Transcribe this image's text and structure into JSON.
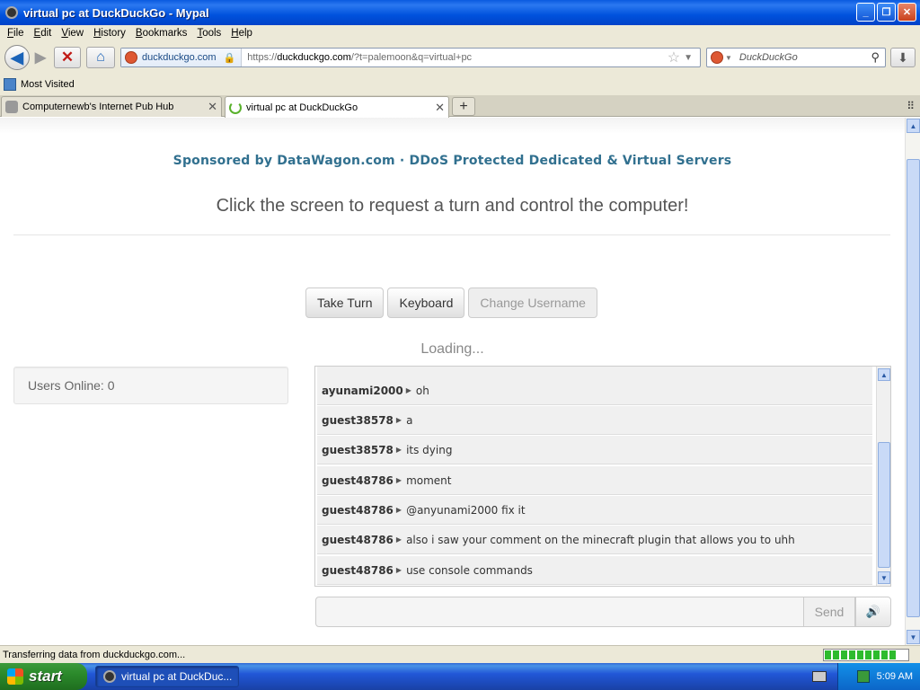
{
  "window": {
    "title": "virtual pc at DuckDuckGo - Mypal",
    "buttons": {
      "minimize": "_",
      "restore": "❐",
      "close": "✕"
    }
  },
  "menu": [
    "File",
    "Edit",
    "View",
    "History",
    "Bookmarks",
    "Tools",
    "Help"
  ],
  "nav": {
    "back_icon": "◀",
    "forward_icon": "▶",
    "stop_icon": "✕",
    "home_icon": "⌂",
    "identity": "duckduckgo.com",
    "url_prefix": "https://",
    "url_host": "duckduckgo.com",
    "url_path": "/?t=palemoon&q=virtual+pc",
    "search_placeholder": "DuckDuckGo",
    "download_icon": "⬇"
  },
  "bookmarks": {
    "most_visited": "Most Visited"
  },
  "tabs": [
    {
      "title": "Computernewb's Internet Pub Hub",
      "active": false
    },
    {
      "title": "virtual pc at DuckDuckGo",
      "active": true
    }
  ],
  "page": {
    "sponsor": "Sponsored by DataWagon.com · DDoS Protected Dedicated & Virtual Servers",
    "headline": "Click the screen to request a turn and control the computer!",
    "buttons": {
      "take_turn": "Take Turn",
      "keyboard": "Keyboard",
      "change_username": "Change Username"
    },
    "loading": "Loading...",
    "users_online": "Users Online: 0",
    "chat": [
      {
        "user": "ayunami2000",
        "msg": "oh"
      },
      {
        "user": "guest38578",
        "msg": "a"
      },
      {
        "user": "guest38578",
        "msg": "its dying"
      },
      {
        "user": "guest48786",
        "msg": "moment"
      },
      {
        "user": "guest48786",
        "msg": "@anyunami2000 fix it"
      },
      {
        "user": "guest48786",
        "msg": "also i saw your comment on the minecraft plugin that allows you to uhh"
      },
      {
        "user": "guest48786",
        "msg": "use console commands"
      }
    ],
    "chat_input_value": "",
    "send_label": "Send"
  },
  "status": {
    "text": "Transferring data from duckduckgo.com...",
    "progress_fraction": 0.85
  },
  "taskbar": {
    "start_label": "start",
    "task_title": "virtual pc at DuckDuc...",
    "clock": "5:09 AM"
  }
}
